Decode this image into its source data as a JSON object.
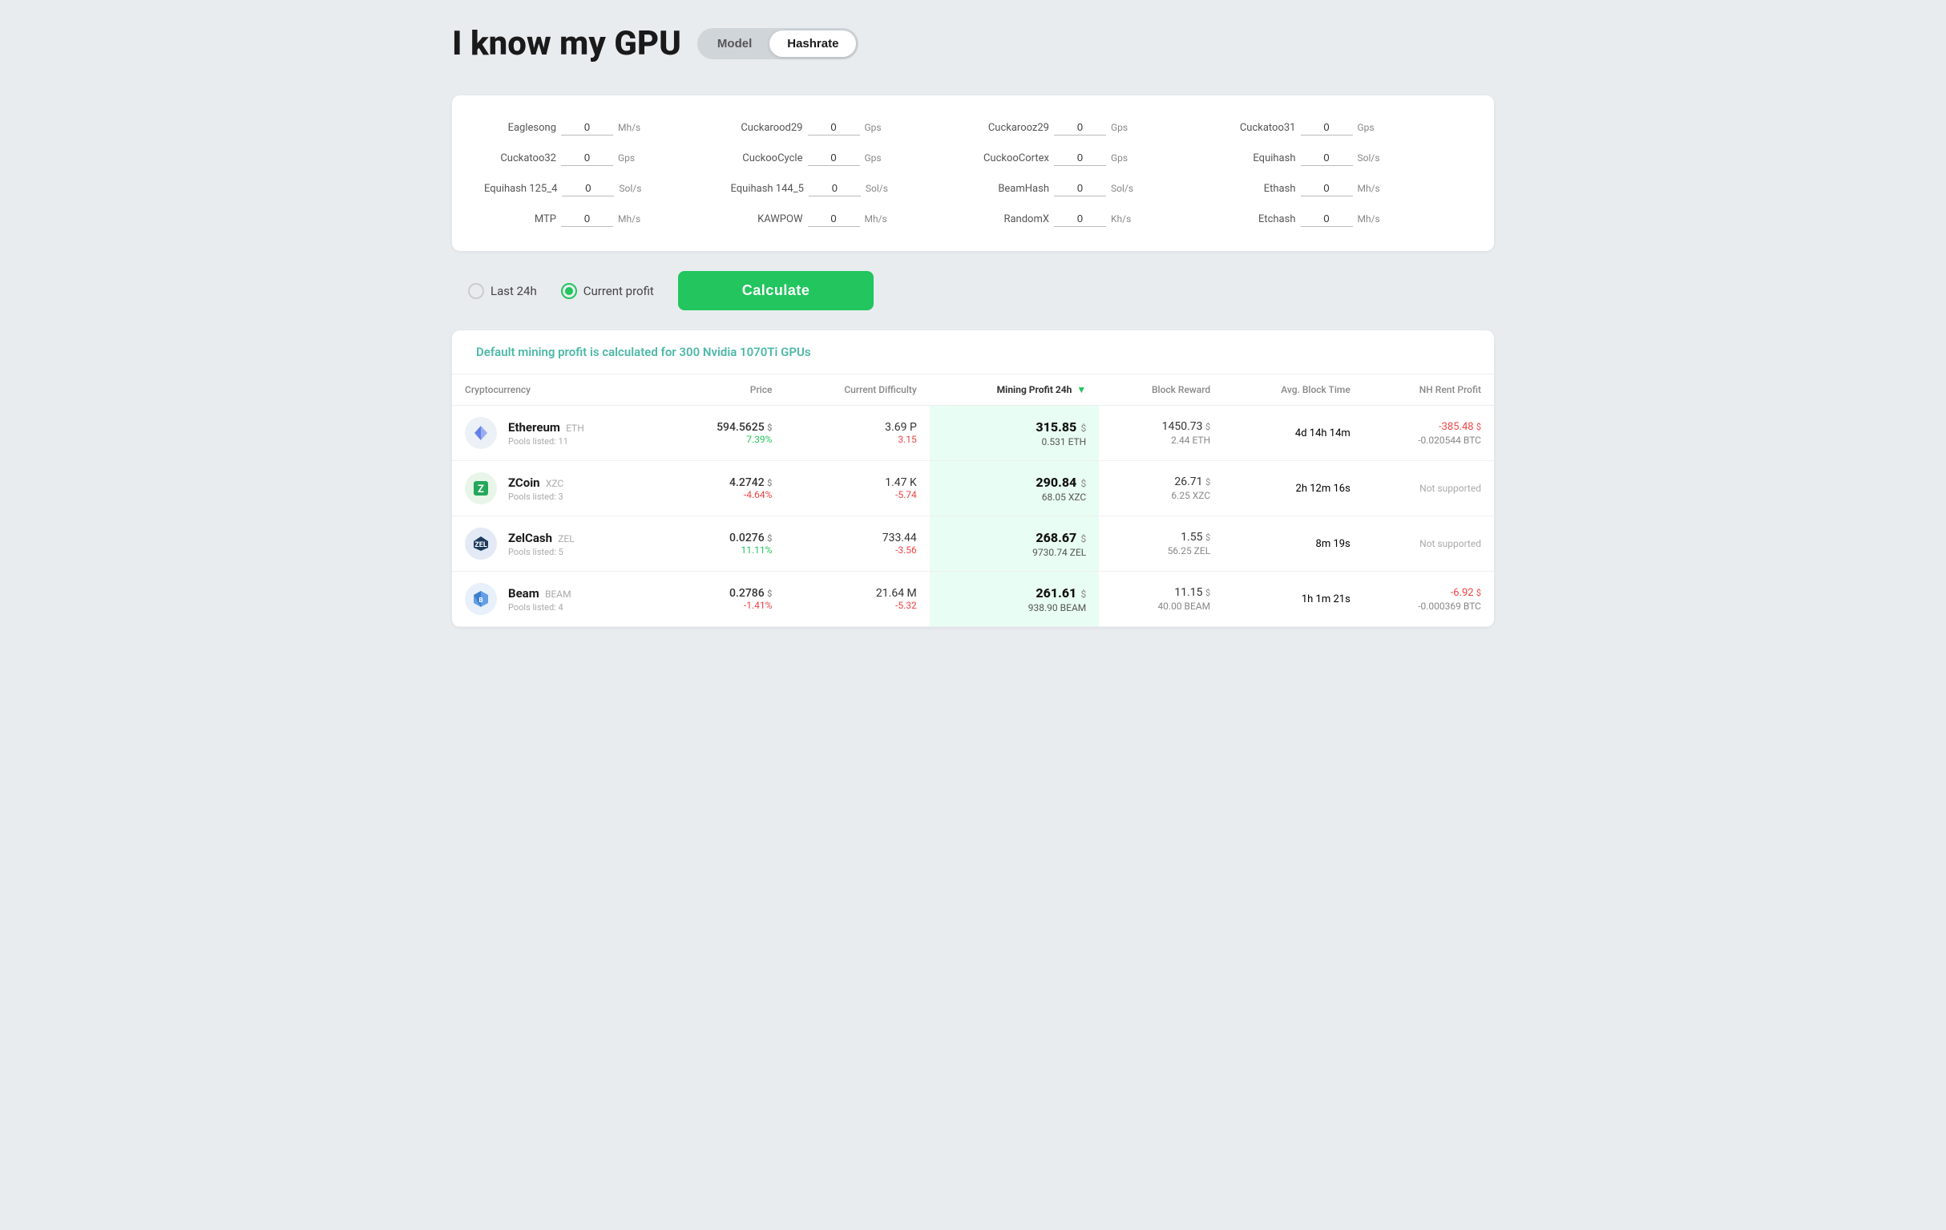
{
  "header": {
    "title": "I know my GPU",
    "toggle": {
      "model_label": "Model",
      "hashrate_label": "Hashrate",
      "active": "hashrate"
    }
  },
  "hashrate_panel": {
    "fields": [
      {
        "label": "Eaglesong",
        "value": "0",
        "unit": "Mh/s"
      },
      {
        "label": "Cuckarood29",
        "value": "0",
        "unit": "Gps"
      },
      {
        "label": "Cuckarooz29",
        "value": "0",
        "unit": "Gps"
      },
      {
        "label": "Cuckatoo31",
        "value": "0",
        "unit": "Gps"
      },
      {
        "label": "Cuckatoo32",
        "value": "0",
        "unit": "Gps"
      },
      {
        "label": "CuckooCycle",
        "value": "0",
        "unit": "Gps"
      },
      {
        "label": "CuckooCortex",
        "value": "0",
        "unit": "Gps"
      },
      {
        "label": "Equihash",
        "value": "0",
        "unit": "Sol/s"
      },
      {
        "label": "Equihash 125_4",
        "value": "0",
        "unit": "Sol/s"
      },
      {
        "label": "Equihash 144_5",
        "value": "0",
        "unit": "Sol/s"
      },
      {
        "label": "BeamHash",
        "value": "0",
        "unit": "Sol/s"
      },
      {
        "label": "Ethash",
        "value": "0",
        "unit": "Mh/s"
      },
      {
        "label": "MTP",
        "value": "0",
        "unit": "Mh/s"
      },
      {
        "label": "KAWPOW",
        "value": "0",
        "unit": "Mh/s"
      },
      {
        "label": "RandomX",
        "value": "0",
        "unit": "Kh/s"
      },
      {
        "label": "Etchash",
        "value": "0",
        "unit": "Mh/s"
      }
    ]
  },
  "controls": {
    "radio_last24": "Last 24h",
    "radio_current": "Current profit",
    "calculate_btn": "Calculate"
  },
  "results": {
    "info_text": "Default mining profit is calculated for 300 Nvidia 1070Ti GPUs",
    "table": {
      "columns": [
        "Cryptocurrency",
        "Price",
        "Current Difficulty",
        "Mining Profit 24h",
        "Block Reward",
        "Avg. Block Time",
        "NH Rent Profit"
      ],
      "rows": [
        {
          "coin": "Ethereum",
          "ticker": "ETH",
          "pools": "Pools listed: 11",
          "icon_type": "eth",
          "price": "594.5625",
          "price_unit": "$",
          "price_change": "7.39%",
          "price_change_dir": "positive",
          "difficulty": "3.69 P",
          "difficulty_sub": "3.15",
          "difficulty_sub_dir": "negative",
          "profit": "315.85",
          "profit_sub": "0.531 ETH",
          "block_reward": "1450.73",
          "block_reward_unit": "$",
          "block_reward_sub": "2.44 ETH",
          "avg_block_time": "4d 14h 14m",
          "nh_profit": "-385.48",
          "nh_profit_unit": "$",
          "nh_profit_sub": "-0.020544 BTC",
          "nh_supported": true
        },
        {
          "coin": "ZCoin",
          "ticker": "XZC",
          "pools": "Pools listed: 3",
          "icon_type": "zcoin",
          "price": "4.2742",
          "price_unit": "$",
          "price_change": "-4.64%",
          "price_change_dir": "negative",
          "difficulty": "1.47 K",
          "difficulty_sub": "-5.74",
          "difficulty_sub_dir": "negative",
          "profit": "290.84",
          "profit_sub": "68.05 XZC",
          "block_reward": "26.71",
          "block_reward_unit": "$",
          "block_reward_sub": "6.25 XZC",
          "avg_block_time": "2h 12m 16s",
          "nh_supported": false,
          "nh_not_supported": "Not supported"
        },
        {
          "coin": "ZelCash",
          "ticker": "ZEL",
          "pools": "Pools listed: 5",
          "icon_type": "zelcash",
          "price": "0.0276",
          "price_unit": "$",
          "price_change": "11.11%",
          "price_change_dir": "positive",
          "difficulty": "733.44",
          "difficulty_sub": "-3.56",
          "difficulty_sub_dir": "negative",
          "profit": "268.67",
          "profit_sub": "9730.74 ZEL",
          "block_reward": "1.55",
          "block_reward_unit": "$",
          "block_reward_sub": "56.25 ZEL",
          "avg_block_time": "8m 19s",
          "nh_supported": false,
          "nh_not_supported": "Not supported"
        },
        {
          "coin": "Beam",
          "ticker": "BEAM",
          "pools": "Pools listed: 4",
          "icon_type": "beam",
          "price": "0.2786",
          "price_unit": "$",
          "price_change": "-1.41%",
          "price_change_dir": "negative",
          "difficulty": "21.64 M",
          "difficulty_sub": "-5.32",
          "difficulty_sub_dir": "negative",
          "profit": "261.61",
          "profit_sub": "938.90 BEAM",
          "block_reward": "11.15",
          "block_reward_unit": "$",
          "block_reward_sub": "40.00 BEAM",
          "avg_block_time": "1h 1m 21s",
          "nh_profit": "-6.92",
          "nh_profit_unit": "$",
          "nh_profit_sub": "-0.000369 BTC",
          "nh_supported": true
        }
      ]
    }
  }
}
